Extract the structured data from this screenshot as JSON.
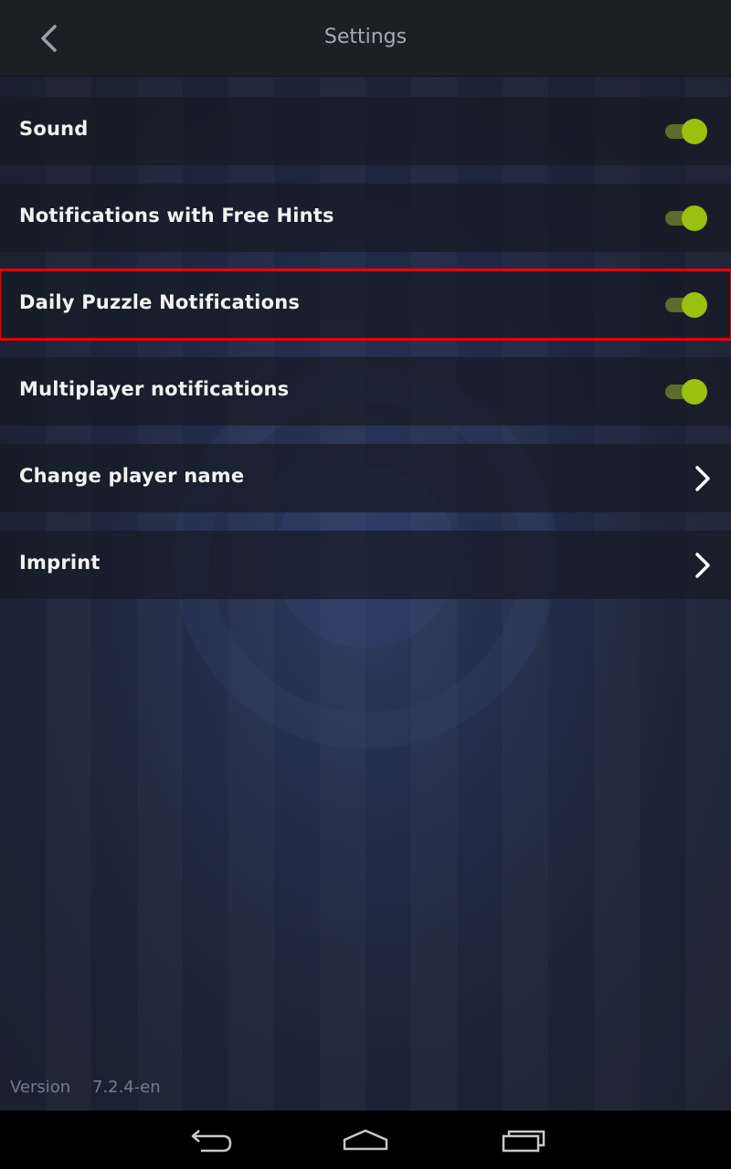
{
  "header": {
    "title": "Settings",
    "back_icon": "chevron-left-icon"
  },
  "settings": {
    "sound": {
      "label": "Sound",
      "enabled": true
    },
    "free_hints": {
      "label": "Notifications with Free Hints",
      "enabled": true
    },
    "daily_puzzle": {
      "label": "Daily Puzzle Notifications",
      "enabled": true
    },
    "multiplayer": {
      "label": "Multiplayer notifications",
      "enabled": true
    },
    "change_name": {
      "label": "Change player name",
      "icon": "chevron-right-icon"
    },
    "imprint": {
      "label": "Imprint",
      "icon": "chevron-right-icon"
    }
  },
  "footer": {
    "version_label": "Version",
    "version_value": "7.2.4-en"
  },
  "system_nav": {
    "back_icon": "back-arrow-icon",
    "home_icon": "home-icon",
    "recents_icon": "recent-apps-icon"
  },
  "colors": {
    "toggle_on_knob": "#99c10f",
    "toggle_on_track": "#5b6c2b",
    "highlight_outline": "#e8000b",
    "header_bg": "#1e1f22",
    "title_text": "#a4aab7"
  }
}
